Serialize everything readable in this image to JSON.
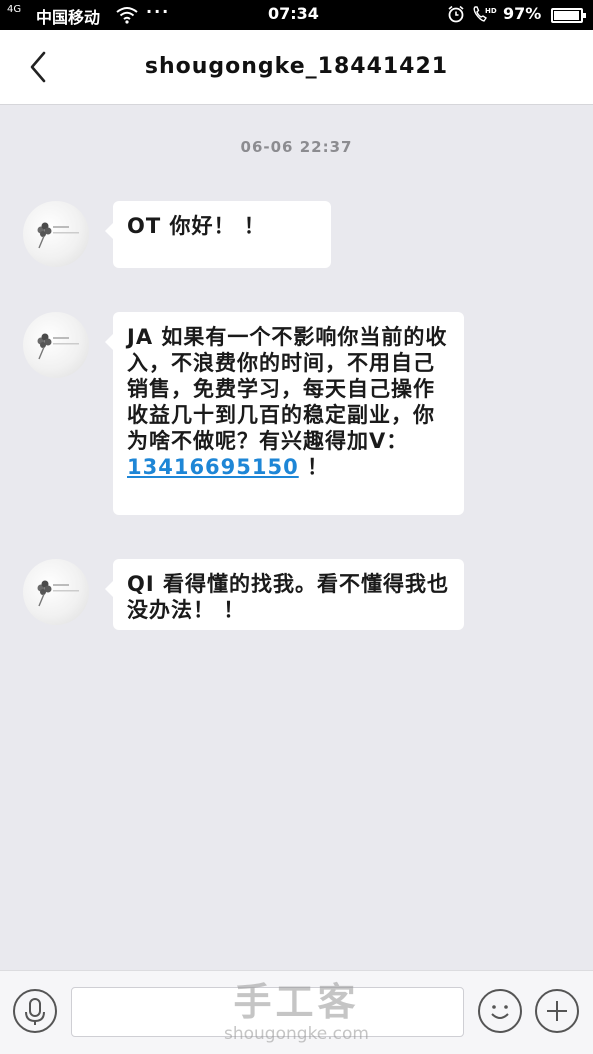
{
  "status_bar": {
    "signal": "4G",
    "carrier": "中国移动",
    "time": "07:34",
    "battery_pct": "97%",
    "battery_level": 0.97
  },
  "header": {
    "title": "shougongke_18441421"
  },
  "chat": {
    "timestamp": "06-06  22:37",
    "messages": [
      {
        "text": "OT  你好！  ！"
      },
      {
        "text": "JA  如果有一个不影响你当前的收入，不浪费你的时间，不用自己销售，免费学习，每天自己操作收益几十到几百的稳定副业，你为啥不做呢？有兴趣得加V：",
        "link": "13416695150",
        "tail": "  ！"
      },
      {
        "text": "QI  看得懂的找我。看不懂得我也没办法！   ！"
      }
    ]
  },
  "icons": {
    "back": "chevron-left-icon",
    "voice": "microphone-icon",
    "emoji": "smiley-icon",
    "more": "plus-icon",
    "wifi": "wifi-icon",
    "alarm": "alarm-icon",
    "call": "hd-call-icon"
  },
  "watermark": {
    "title": "手工客",
    "subtitle": "shougongke.com"
  },
  "colors": {
    "background": "#e9e9ee",
    "bubble": "#ffffff",
    "link": "#1e86d6",
    "status_bar": "#000000"
  }
}
